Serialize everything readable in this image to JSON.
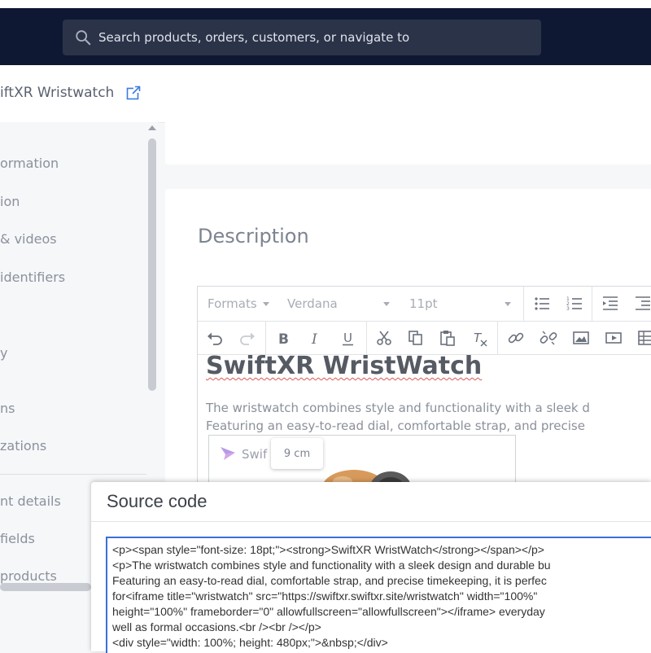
{
  "topbar": {
    "search_placeholder": "Search products, orders, customers, or navigate to",
    "search_icon": "search-icon"
  },
  "product": {
    "title": "iftXR Wristwatch",
    "external_icon": "external-link-icon"
  },
  "sidebar": {
    "items": [
      {
        "label": "ormation"
      },
      {
        "label": "ion"
      },
      {
        "label": "& videos"
      },
      {
        "label": "identifiers"
      },
      {
        "label": "y"
      },
      {
        "label": "ns"
      },
      {
        "label": "zations"
      },
      {
        "label": "nt details"
      },
      {
        "label": "fields"
      },
      {
        "label": "products"
      }
    ]
  },
  "main": {
    "description_heading": "Description"
  },
  "editor": {
    "formats_label": "Formats",
    "font_label": "Verdana",
    "size_label": "11pt",
    "content_title": "SwiftXR WristWatch",
    "content_lines": [
      "The wristwatch combines style and functionality with a sleek d",
      "Featuring an easy-to-read dial, comfortable strap, and precise"
    ],
    "iframe_label": "Swif",
    "dimension_tooltip": "9 cm"
  },
  "modal": {
    "title": "Source code",
    "code_lines": [
      "<p><span style=\"font-size: 18pt;\"><strong>SwiftXR WristWatch</strong></span></p>",
      "<p>The wristwatch combines style and functionality with a sleek design and durable bu",
      "Featuring an easy-to-read dial, comfortable strap, and precise timekeeping, it is perfec",
      "for<iframe title=\"wristwatch\" src=\"https://swiftxr.swiftxr.site/wristwatch\" width=\"100%\"",
      "height=\"100%\" frameborder=\"0\" allowfullscreen=\"allowfullscreen\"></iframe> everyday",
      "well as formal occasions.<br /><br /></p>",
      "<div style=\"width: 100%; height: 480px;\">&nbsp;</div>"
    ]
  },
  "colors": {
    "topbar_bg": "#0f1833",
    "search_bg": "#2b3349",
    "focus_border": "#3b6fd4",
    "link_icon": "#3b7be0"
  }
}
